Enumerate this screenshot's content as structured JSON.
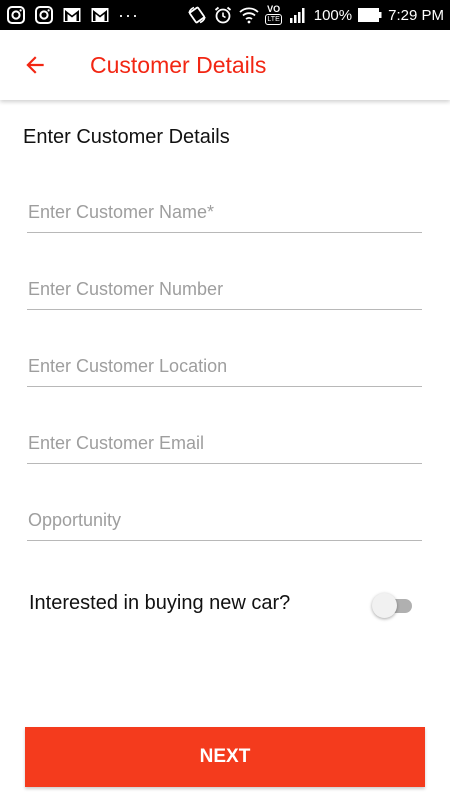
{
  "status_bar": {
    "icons": [
      "instagram-icon",
      "instagram-icon",
      "gmail-icon",
      "gmail-icon",
      "more-notifications-icon",
      "rotate-icon",
      "alarm-icon",
      "wifi-icon",
      "volte-icon",
      "signal-icon"
    ],
    "volte_top": "VO",
    "volte_bottom": "LTE",
    "more": "···",
    "battery": "100%",
    "time": "7:29 PM"
  },
  "app_bar": {
    "title": "Customer Details",
    "back_icon": "arrow-back-icon"
  },
  "form": {
    "heading": "Enter Customer Details",
    "fields": [
      {
        "placeholder": "Enter Customer Name*",
        "value": ""
      },
      {
        "placeholder": "Enter Customer Number",
        "value": ""
      },
      {
        "placeholder": "Enter Customer Location",
        "value": ""
      },
      {
        "placeholder": "Enter Customer Email",
        "value": ""
      },
      {
        "placeholder": "Opportunity",
        "value": ""
      }
    ],
    "toggle": {
      "label": "Interested in buying new car?",
      "on": false
    }
  },
  "actions": {
    "next_label": "NEXT"
  },
  "colors": {
    "accent": "#f22613",
    "button": "#f43b1d",
    "status_bar": "#000000"
  }
}
